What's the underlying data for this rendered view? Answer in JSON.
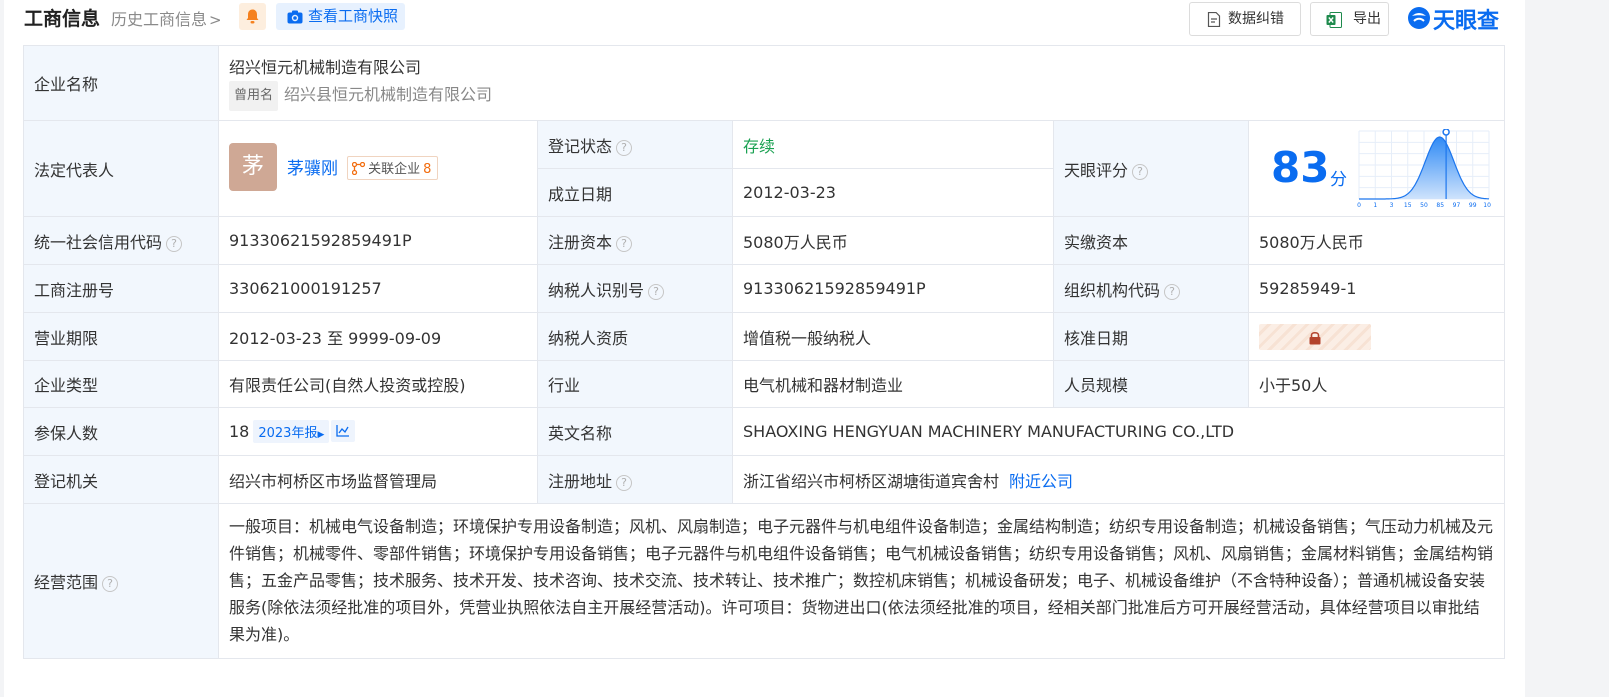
{
  "header": {
    "title": "工商信息",
    "history": "历史工商信息",
    "snapshot_button": "查看工商快照",
    "correct_button": "数据纠错",
    "export_button": "导出",
    "logo_text": "天眼查"
  },
  "rows": {
    "company_name_label": "企业名称",
    "company_name": "绍兴恒元机械制造有限公司",
    "used_name_tag": "曾用名",
    "used_name": "绍兴县恒元机械制造有限公司",
    "legal_rep_label": "法定代表人",
    "avatar_char": "茅",
    "legal_rep": "茅骥刚",
    "related_label": "关联企业",
    "related_count": "8",
    "reg_status_label": "登记状态",
    "reg_status": "存续",
    "found_date_label": "成立日期",
    "found_date": "2012-03-23",
    "score_label": "天眼评分",
    "score": "83",
    "score_unit": "分",
    "credit_code_label": "统一社会信用代码",
    "credit_code": "91330621592859491P",
    "reg_capital_label": "注册资本",
    "reg_capital": "5080万人民币",
    "paid_capital_label": "实缴资本",
    "paid_capital": "5080万人民币",
    "reg_no_label": "工商注册号",
    "reg_no": "330621000191257",
    "taxpayer_id_label": "纳税人识别号",
    "taxpayer_id": "91330621592859491P",
    "org_code_label": "组织机构代码",
    "org_code": "59285949-1",
    "term_label": "营业期限",
    "term": "2012-03-23 至 9999-09-09",
    "taxpayer_qual_label": "纳税人资质",
    "taxpayer_qual": "增值税一般纳税人",
    "approve_date_label": "核准日期",
    "type_label": "企业类型",
    "type": "有限责任公司(自然人投资或控股)",
    "industry_label": "行业",
    "industry": "电气机械和器材制造业",
    "staff_label": "人员规模",
    "staff": "小于50人",
    "insured_label": "参保人数",
    "insured": "18",
    "insured_report": "2023年报",
    "en_name_label": "英文名称",
    "en_name": "SHAOXING HENGYUAN MACHINERY MANUFACTURING CO.,LTD",
    "authority_label": "登记机关",
    "authority": "绍兴市柯桥区市场监督管理局",
    "address_label": "注册地址",
    "address": "浙江省绍兴市柯桥区湖塘街道宾舍村",
    "nearby": "附近公司",
    "scope_label": "经营范围",
    "scope": "一般项目：机械电气设备制造；环境保护专用设备制造；风机、风扇制造；电子元器件与机电组件设备制造；金属结构制造；纺织专用设备制造；机械设备销售；气压动力机械及元件销售；机械零件、零部件销售；环境保护专用设备销售；电子元器件与机电组件设备销售；电气机械设备销售；纺织专用设备销售；风机、风扇销售；金属材料销售；金属结构销售；五金产品零售；技术服务、技术开发、技术咨询、技术交流、技术转让、技术推广；数控机床销售；机械设备研发；电子、机械设备维护（不含特种设备）；普通机械设备安装服务(除依法须经批准的项目外，凭营业执照依法自主开展经营活动)。许可项目：货物进出口(依法须经批准的项目，经相关部门批准后方可开展经营活动，具体经营项目以审批结果为准)。"
  },
  "score_chart": {
    "type": "area",
    "x_ticks": [
      "0",
      "1",
      "3",
      "15",
      "50",
      "85",
      "97",
      "99",
      "100"
    ],
    "marker_value": 83
  },
  "colors": {
    "accent": "#0a6cf0",
    "status_green": "#1aa152",
    "label_bg": "#f2f7fd"
  }
}
